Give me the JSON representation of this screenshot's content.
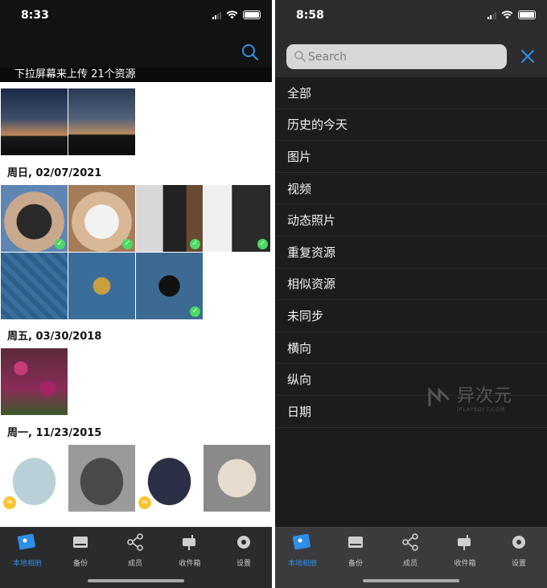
{
  "left": {
    "status_time": "8:33",
    "pull_banner": "下拉屏幕来上传 21个资源",
    "sections": [
      {
        "date": "周日, 02/07/2021"
      },
      {
        "date": "周五, 03/30/2018"
      },
      {
        "date": "周一, 11/23/2015"
      }
    ]
  },
  "right": {
    "status_time": "8:58",
    "search": {
      "placeholder": "Search"
    },
    "menu": [
      {
        "label": "全部"
      },
      {
        "label": "历史的今天"
      },
      {
        "label": "图片"
      },
      {
        "label": "视频"
      },
      {
        "label": "动态照片"
      },
      {
        "label": "重复资源"
      },
      {
        "label": "相似资源"
      },
      {
        "label": "未同步"
      },
      {
        "label": "横向"
      },
      {
        "label": "纵向"
      },
      {
        "label": "日期"
      }
    ],
    "watermark": {
      "cn": "异次元",
      "en": "IPLAYSOFT.COM"
    }
  },
  "tabs": [
    {
      "label": "本地相册",
      "icon": "photo-album-icon"
    },
    {
      "label": "备份",
      "icon": "drive-icon"
    },
    {
      "label": "成员",
      "icon": "share-icon"
    },
    {
      "label": "收件箱",
      "icon": "mailbox-icon"
    },
    {
      "label": "设置",
      "icon": "gear-icon"
    }
  ],
  "colors": {
    "accent": "#2f8fe8",
    "synced_check": "#4cd964",
    "live_badge": "#f7c433"
  }
}
